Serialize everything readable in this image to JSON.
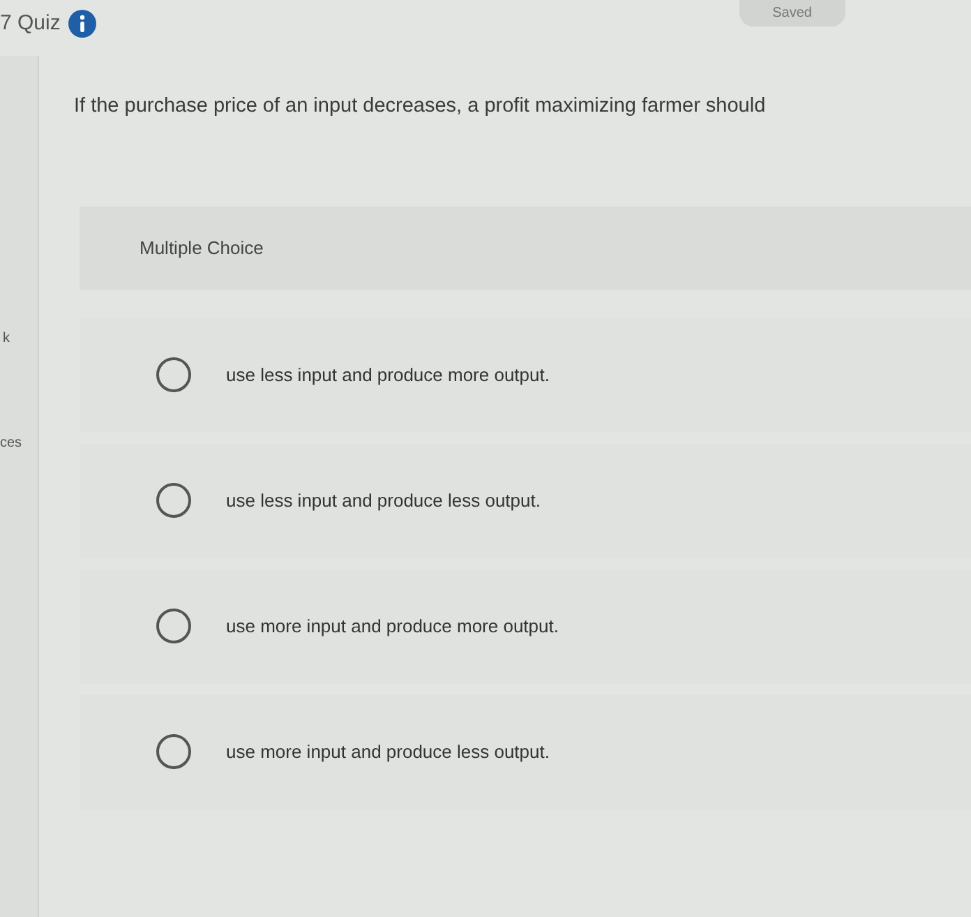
{
  "header": {
    "title": "7 Quiz",
    "status": "Saved"
  },
  "sidebar": {
    "items": [
      "k",
      "ces"
    ]
  },
  "question": {
    "text": "If the purchase price of an input decreases, a profit maximizing farmer should",
    "type_label": "Multiple Choice",
    "options": [
      {
        "label": "use less input and produce more output.",
        "selected": false
      },
      {
        "label": "use less input and produce less output.",
        "selected": false
      },
      {
        "label": "use more input and produce more output.",
        "selected": false
      },
      {
        "label": "use more input and produce less output.",
        "selected": false
      }
    ]
  }
}
